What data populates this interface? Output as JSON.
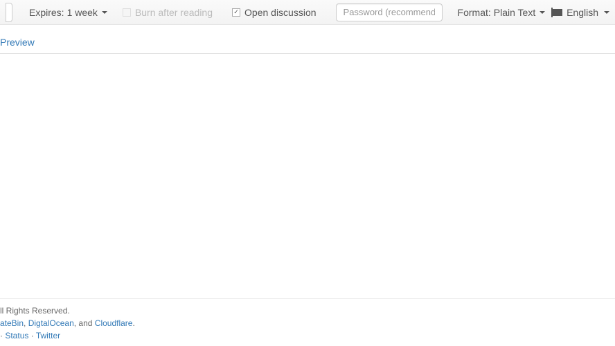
{
  "toolbar": {
    "expires": {
      "label": "Expires:",
      "value": "1 week"
    },
    "burn": {
      "label": "Burn after reading",
      "checked": false,
      "enabled": false
    },
    "discussion": {
      "label": "Open discussion",
      "checked": true
    },
    "password_placeholder": "Password (recommended)",
    "format": {
      "label": "Format:",
      "value": "Plain Text"
    },
    "language": "English"
  },
  "tabs": {
    "preview": "Preview"
  },
  "footer": {
    "rights": "ll Rights Reserved.",
    "powered_prefix": "",
    "link_privatebin": "ateBin",
    "sep1": ", ",
    "link_digitalocean": "DigtalOcean",
    "sep2": ", and ",
    "link_cloudflare": "Cloudflare",
    "period": ".",
    "dot": " · ",
    "link_status": "Status",
    "link_twitter": "Twitter"
  }
}
